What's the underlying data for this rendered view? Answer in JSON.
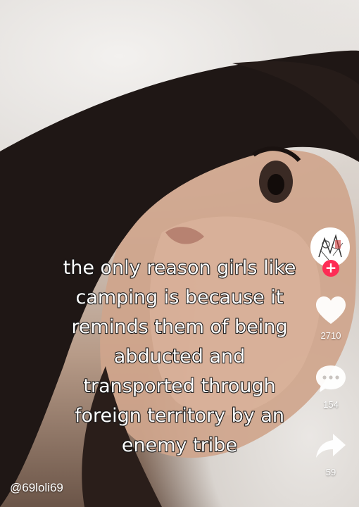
{
  "caption": {
    "lines": [
      "the only reason girls like",
      "camping is because it",
      "reminds them of being",
      "abducted and",
      "transported through",
      "foreign territory by an",
      "enemy tribe"
    ]
  },
  "actions": {
    "like_count": "2710",
    "comment_count": "154",
    "share_count": "59",
    "follow_symbol": "+"
  },
  "author": {
    "username": "@69loli69"
  },
  "colors": {
    "follow_badge": "#fe2c55",
    "icon_fill": "#ffffff"
  },
  "icons": [
    "heart-icon",
    "comment-icon",
    "share-icon",
    "plus-icon"
  ]
}
